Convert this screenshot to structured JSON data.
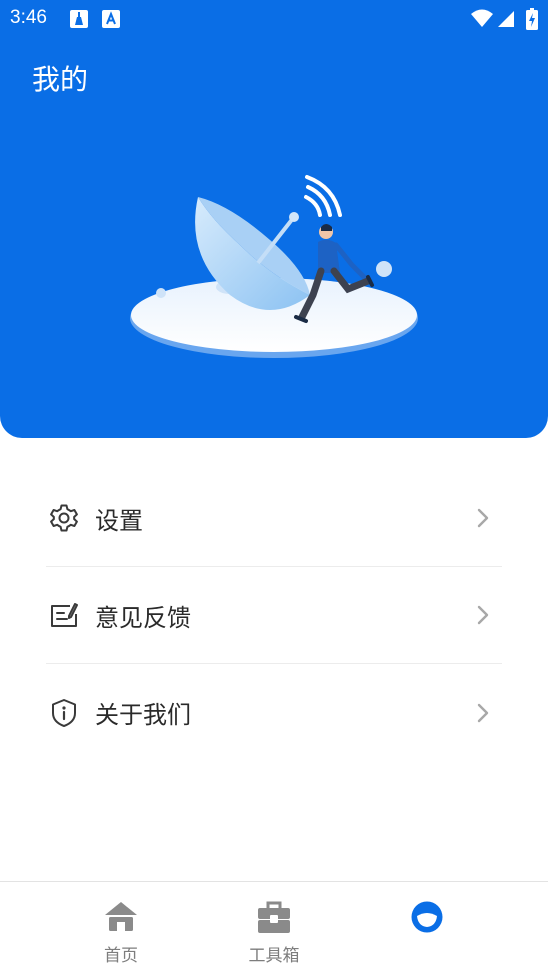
{
  "status_bar": {
    "time": "3:46"
  },
  "header": {
    "title": "我的"
  },
  "menu": {
    "items": [
      {
        "label": "设置",
        "icon": "gear-icon"
      },
      {
        "label": "意见反馈",
        "icon": "feedback-icon"
      },
      {
        "label": "关于我们",
        "icon": "shield-info-icon"
      }
    ]
  },
  "tabbar": {
    "tabs": [
      {
        "label": "首页",
        "icon": "home-icon",
        "active": false
      },
      {
        "label": "工具箱",
        "icon": "toolbox-icon",
        "active": false
      },
      {
        "label": "",
        "icon": "profile-icon",
        "active": true
      }
    ]
  },
  "colors": {
    "primary": "#0a6ee6",
    "inactive": "#8a8a8a",
    "text": "#2a2a2a"
  }
}
